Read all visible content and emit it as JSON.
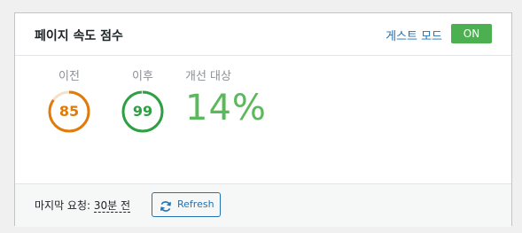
{
  "header": {
    "title": "페이지 속도 점수",
    "guest_mode_label": "게스트 모드",
    "toggle_label": "ON",
    "toggle_on": true
  },
  "scores": {
    "before": {
      "label": "이전",
      "value": "85",
      "score": 85,
      "color": "#e07b0a"
    },
    "after": {
      "label": "이후",
      "value": "99",
      "score": 99,
      "color": "#2ea043"
    },
    "improvement": {
      "label": "개선 대상",
      "value": "14%",
      "color": "#5cb85c"
    }
  },
  "footer": {
    "last_request_label": "마지막 요청:",
    "last_request_ago": "30분 전",
    "refresh_label": "Refresh"
  },
  "icons": {
    "refresh": "refresh-icon"
  }
}
